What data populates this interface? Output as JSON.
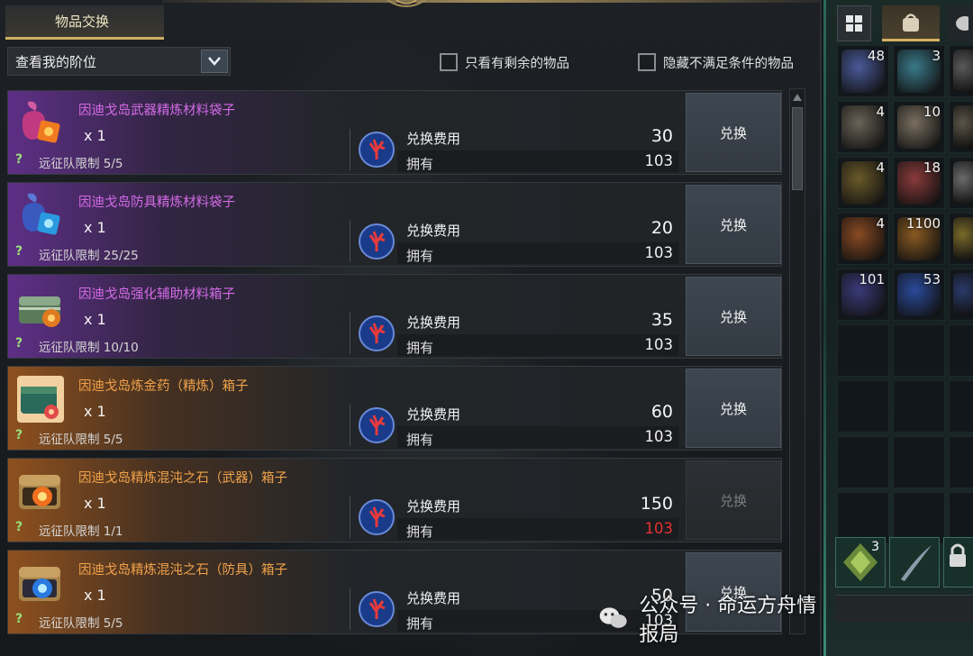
{
  "header": {
    "tab_label": "物品交换",
    "tier_select_value": "查看我的阶位",
    "filter_surplus_label": "只看有剩余的物品",
    "filter_hide_unmet_label": "隐藏不满足条件的物品"
  },
  "labels": {
    "cost": "兑换费用",
    "own": "拥有",
    "help": "?"
  },
  "items": [
    {
      "name": "因迪戈岛武器精炼材料袋子",
      "qty": "x 1",
      "limit": "远征队限制 5/5",
      "cost": "30",
      "own": "103",
      "button": "兑换",
      "rarity": "purple",
      "icon": "purple-pouch-icon",
      "enabled": true,
      "affordable": true
    },
    {
      "name": "因迪戈岛防具精炼材料袋子",
      "qty": "x 1",
      "limit": "远征队限制 25/25",
      "cost": "20",
      "own": "103",
      "button": "兑换",
      "rarity": "purple",
      "icon": "blue-pouch-icon",
      "enabled": true,
      "affordable": true
    },
    {
      "name": "因迪戈岛强化辅助材料箱子",
      "qty": "x 1",
      "limit": "远征队限制 10/10",
      "cost": "35",
      "own": "103",
      "button": "兑换",
      "rarity": "purple",
      "icon": "green-chest-icon",
      "enabled": true,
      "affordable": true
    },
    {
      "name": "因迪戈岛炼金药（精炼）箱子",
      "qty": "x 1",
      "limit": "远征队限制 5/5",
      "cost": "60",
      "own": "103",
      "button": "兑换",
      "rarity": "orange",
      "icon": "potion-chest-icon",
      "enabled": true,
      "affordable": true
    },
    {
      "name": "因迪戈岛精炼混沌之石（武器）箱子",
      "qty": "x 1",
      "limit": "远征队限制 1/1",
      "cost": "150",
      "own": "103",
      "button": "兑换",
      "rarity": "orange",
      "icon": "chaos-stone-weapon-chest-icon",
      "enabled": false,
      "affordable": false
    },
    {
      "name": "因迪戈岛精炼混沌之石（防具）箱子",
      "qty": "x 1",
      "limit": "远征队限制 5/5",
      "cost": "50",
      "own": "103",
      "button": "兑换",
      "rarity": "orange",
      "icon": "chaos-stone-armor-chest-icon",
      "enabled": true,
      "affordable": true
    }
  ],
  "inventory": {
    "tabs": [
      "grid-icon",
      "bag-icon",
      "other-tab-icon"
    ],
    "slots": [
      {
        "count": "48",
        "icon": "blue-orb-icon",
        "color": "#4a5a9a"
      },
      {
        "count": "3",
        "icon": "teal-orb-icon",
        "color": "#3a7a8a"
      },
      {
        "count": "",
        "icon": "partial-item-icon",
        "color": "#5a5a5a"
      },
      {
        "count": "4",
        "icon": "ore-icon",
        "color": "#6a6458"
      },
      {
        "count": "10",
        "icon": "ore-icon",
        "color": "#7a7060"
      },
      {
        "count": "",
        "icon": "partial-item-icon",
        "color": "#5a5448"
      },
      {
        "count": "4",
        "icon": "horn-icon",
        "color": "#6a5a2a"
      },
      {
        "count": "18",
        "icon": "red-stone-icon",
        "color": "#8a3a3a"
      },
      {
        "count": "",
        "icon": "partial-item-icon",
        "color": "#6a6a6a"
      },
      {
        "count": "4",
        "icon": "flame-crest-icon",
        "color": "#8a4a22"
      },
      {
        "count": "1100",
        "icon": "flame-crest-icon",
        "color": "#8a5a22"
      },
      {
        "count": "",
        "icon": "partial-item-icon",
        "color": "#7a6a2a"
      },
      {
        "count": "101",
        "icon": "dark-gem-icon",
        "color": "#3a3a7a"
      },
      {
        "count": "53",
        "icon": "blue-gem-icon",
        "color": "#2a4a9a"
      },
      {
        "count": "",
        "icon": "partial-item-icon",
        "color": "#2a3a6a"
      }
    ],
    "equip_slots": [
      {
        "count": "3",
        "icon": "emblem-icon"
      },
      {
        "count": "",
        "icon": "feather-icon"
      },
      {
        "count": "",
        "icon": "lock-icon"
      }
    ]
  },
  "watermark": "公众号 · 命运方舟情报局"
}
